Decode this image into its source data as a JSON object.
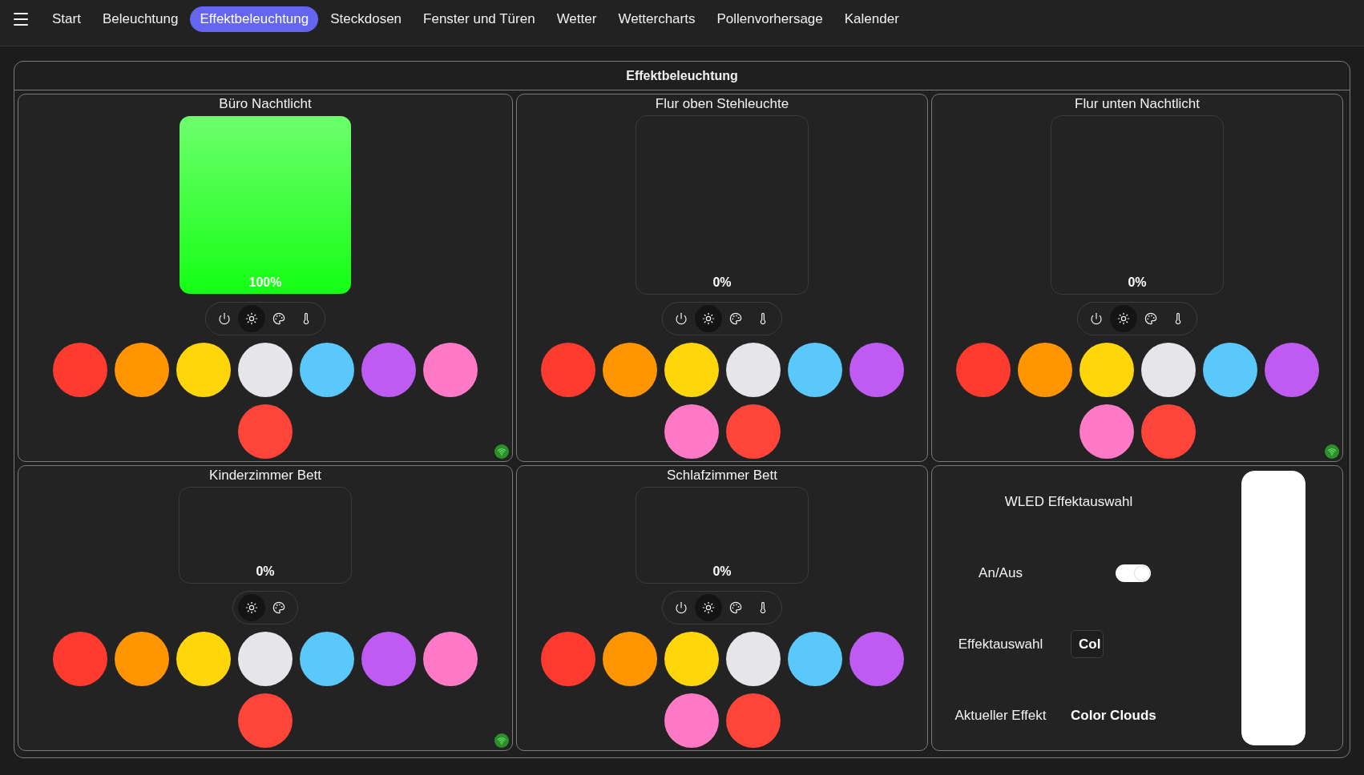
{
  "nav": {
    "items": [
      {
        "label": "Start",
        "selected": false
      },
      {
        "label": "Beleuchtung",
        "selected": false
      },
      {
        "label": "Effektbeleuchtung",
        "selected": true
      },
      {
        "label": "Steckdosen",
        "selected": false
      },
      {
        "label": "Fenster und Türen",
        "selected": false
      },
      {
        "label": "Wetter",
        "selected": false
      },
      {
        "label": "Wettercharts",
        "selected": false
      },
      {
        "label": "Pollenvorhersage",
        "selected": false
      },
      {
        "label": "Kalender",
        "selected": false
      }
    ]
  },
  "panel": {
    "title": "Effektbeleuchtung"
  },
  "cards": [
    {
      "kind": "light",
      "title": "Büro Nachtlicht",
      "brightness": {
        "level": 1,
        "reading": "100%",
        "color": "#14ff14"
      },
      "controls": [
        {
          "kind": "power",
          "selected": false
        },
        {
          "kind": "brightness",
          "selected": true
        },
        {
          "kind": "color",
          "selected": false
        },
        {
          "kind": "temperature",
          "selected": false
        }
      ],
      "swatches": [
        {
          "color": "#ff3b30"
        },
        {
          "color": "#ff9500"
        },
        {
          "color": "#ffd60a"
        },
        {
          "color": "#e5e5ea"
        },
        {
          "color": "#5ac8fa"
        },
        {
          "color": "#bf5af2"
        },
        {
          "color": "#ff79c6"
        },
        {
          "color": "#ff453a"
        }
      ],
      "connected": true
    },
    {
      "kind": "light",
      "title": "Flur oben Stehleuchte",
      "brightness": {
        "level": 0,
        "reading": "0%"
      },
      "controls": [
        {
          "kind": "power",
          "selected": false
        },
        {
          "kind": "brightness",
          "selected": true
        },
        {
          "kind": "color",
          "selected": false
        },
        {
          "kind": "temperature",
          "selected": false
        }
      ],
      "swatches": [
        {
          "color": "#ff3b30"
        },
        {
          "color": "#ff9500"
        },
        {
          "color": "#ffd60a"
        },
        {
          "color": "#e5e5ea"
        },
        {
          "color": "#5ac8fa"
        },
        {
          "color": "#bf5af2"
        },
        {
          "color": "#ff79c6"
        },
        {
          "color": "#ff453a"
        }
      ],
      "connected": false
    },
    {
      "kind": "light",
      "title": "Flur unten Nachtlicht",
      "brightness": {
        "level": 0,
        "reading": "0%"
      },
      "controls": [
        {
          "kind": "power",
          "selected": false
        },
        {
          "kind": "brightness",
          "selected": true
        },
        {
          "kind": "color",
          "selected": false
        },
        {
          "kind": "temperature",
          "selected": false
        }
      ],
      "swatches": [
        {
          "color": "#ff3b30"
        },
        {
          "color": "#ff9500"
        },
        {
          "color": "#ffd60a"
        },
        {
          "color": "#e5e5ea"
        },
        {
          "color": "#5ac8fa"
        },
        {
          "color": "#bf5af2"
        },
        {
          "color": "#ff79c6"
        },
        {
          "color": "#ff453a"
        }
      ],
      "connected": true
    },
    {
      "kind": "light",
      "title": "Kinderzimmer Bett",
      "brightness": {
        "level": 0,
        "reading": "0%"
      },
      "controls": [
        {
          "kind": "brightness",
          "selected": true
        },
        {
          "kind": "color",
          "selected": false
        }
      ],
      "swatches": [
        {
          "color": "#ff3b30"
        },
        {
          "color": "#ff9500"
        },
        {
          "color": "#ffd60a"
        },
        {
          "color": "#e5e5ea"
        },
        {
          "color": "#5ac8fa"
        },
        {
          "color": "#bf5af2"
        },
        {
          "color": "#ff79c6"
        },
        {
          "color": "#ff453a"
        }
      ],
      "connected": true
    },
    {
      "kind": "light",
      "title": "Schlafzimmer Bett",
      "brightness": {
        "level": 0,
        "reading": "0%"
      },
      "controls": [
        {
          "kind": "power",
          "selected": false
        },
        {
          "kind": "brightness",
          "selected": true
        },
        {
          "kind": "color",
          "selected": false
        },
        {
          "kind": "temperature",
          "selected": false
        }
      ],
      "swatches": [
        {
          "color": "#ff3b30"
        },
        {
          "color": "#ff9500"
        },
        {
          "color": "#ffd60a"
        },
        {
          "color": "#e5e5ea"
        },
        {
          "color": "#5ac8fa"
        },
        {
          "color": "#bf5af2"
        },
        {
          "color": "#ff79c6"
        },
        {
          "color": "#ff453a"
        }
      ],
      "connected": false
    },
    {
      "kind": "effect",
      "title": "WLED Effektauswahl",
      "rows": [
        {
          "kind": "toggle",
          "label": "An/Aus",
          "on": true
        },
        {
          "kind": "select",
          "label": "Effektauswahl",
          "value": "Col"
        },
        {
          "kind": "text",
          "label": "Aktueller Effekt",
          "value": "Color Clouds"
        }
      ],
      "slider": {
        "level": 1
      }
    }
  ]
}
